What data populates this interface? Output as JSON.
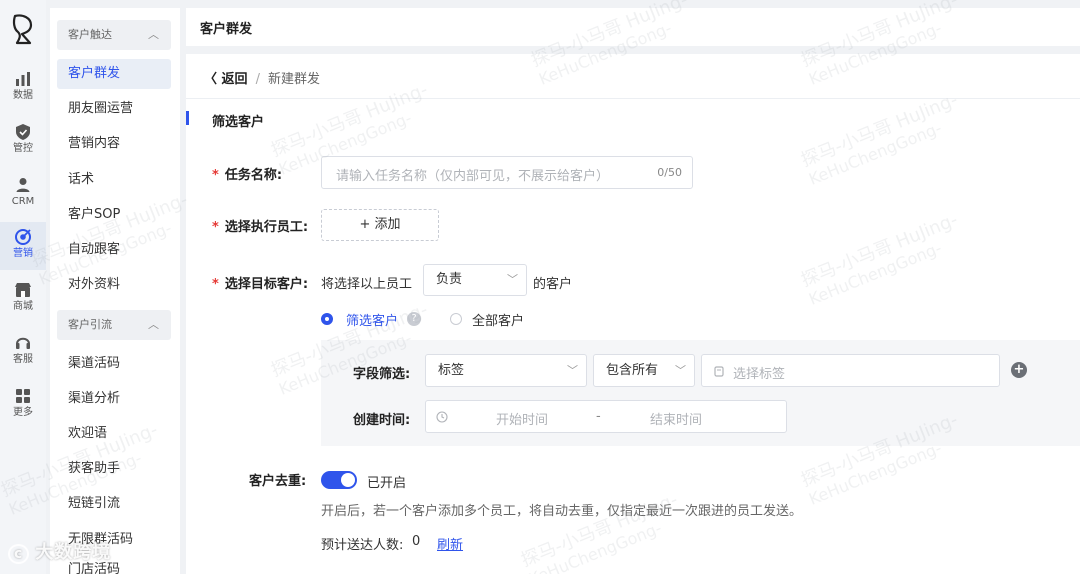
{
  "rail": {
    "items": [
      {
        "label": "数据",
        "icon": "chart-icon"
      },
      {
        "label": "管控",
        "icon": "shield-icon"
      },
      {
        "label": "CRM",
        "icon": "user-icon"
      },
      {
        "label": "营销",
        "icon": "target-icon",
        "active": true
      },
      {
        "label": "商城",
        "icon": "shop-icon"
      },
      {
        "label": "客服",
        "icon": "headset-icon"
      },
      {
        "label": "更多",
        "icon": "grid-icon"
      }
    ]
  },
  "sidebar": {
    "group1": "客户触达",
    "group1_items": [
      "客户群发",
      "朋友圈运营",
      "营销内容",
      "话术",
      "客户SOP",
      "自动跟客",
      "对外资料"
    ],
    "group2": "客户引流",
    "group2_items": [
      "渠道活码",
      "渠道分析",
      "欢迎语",
      "获客助手",
      "短链引流",
      "无限群活码",
      "门店活码"
    ]
  },
  "topbar": {
    "title": "客户群发"
  },
  "breadcrumb": {
    "back": "返回",
    "separator": "/",
    "current": "新建群发"
  },
  "section": {
    "title": "筛选客户"
  },
  "form": {
    "task_name_label": "任务名称:",
    "task_name_placeholder": "请输入任务名称（仅内部可见，不展示给客户）",
    "task_name_count": "0/50",
    "staff_label": "选择执行员工:",
    "staff_add": "+ 添加",
    "target_label": "选择目标客户:",
    "target_prefix": "将选择以上员工",
    "target_select": "负责",
    "target_suffix": "的客户",
    "radio_filter": "筛选客户",
    "radio_all": "全部客户",
    "field_filter_label": "字段筛选:",
    "field_select": "标签",
    "match_select": "包含所有",
    "tag_placeholder": "选择标签",
    "create_time_label": "创建时间:",
    "start_time": "开始时间",
    "time_sep": "-",
    "end_time": "结束时间",
    "dedup_label": "客户去重:",
    "dedup_status": "已开启",
    "dedup_desc": "开启后，若一个客户添加多个员工，将自动去重，仅指定最近一次跟进的员工发送。",
    "estimate_label": "预计送达人数:",
    "estimate_value": "0",
    "refresh": "刷新"
  },
  "watermark": {
    "line1": "探马-小马哥 HuJing-",
    "line2": "KeHuChengGong-"
  },
  "overlay_brand": "大数跨境",
  "colors": {
    "accent": "#2f54eb",
    "required": "#e53935"
  }
}
